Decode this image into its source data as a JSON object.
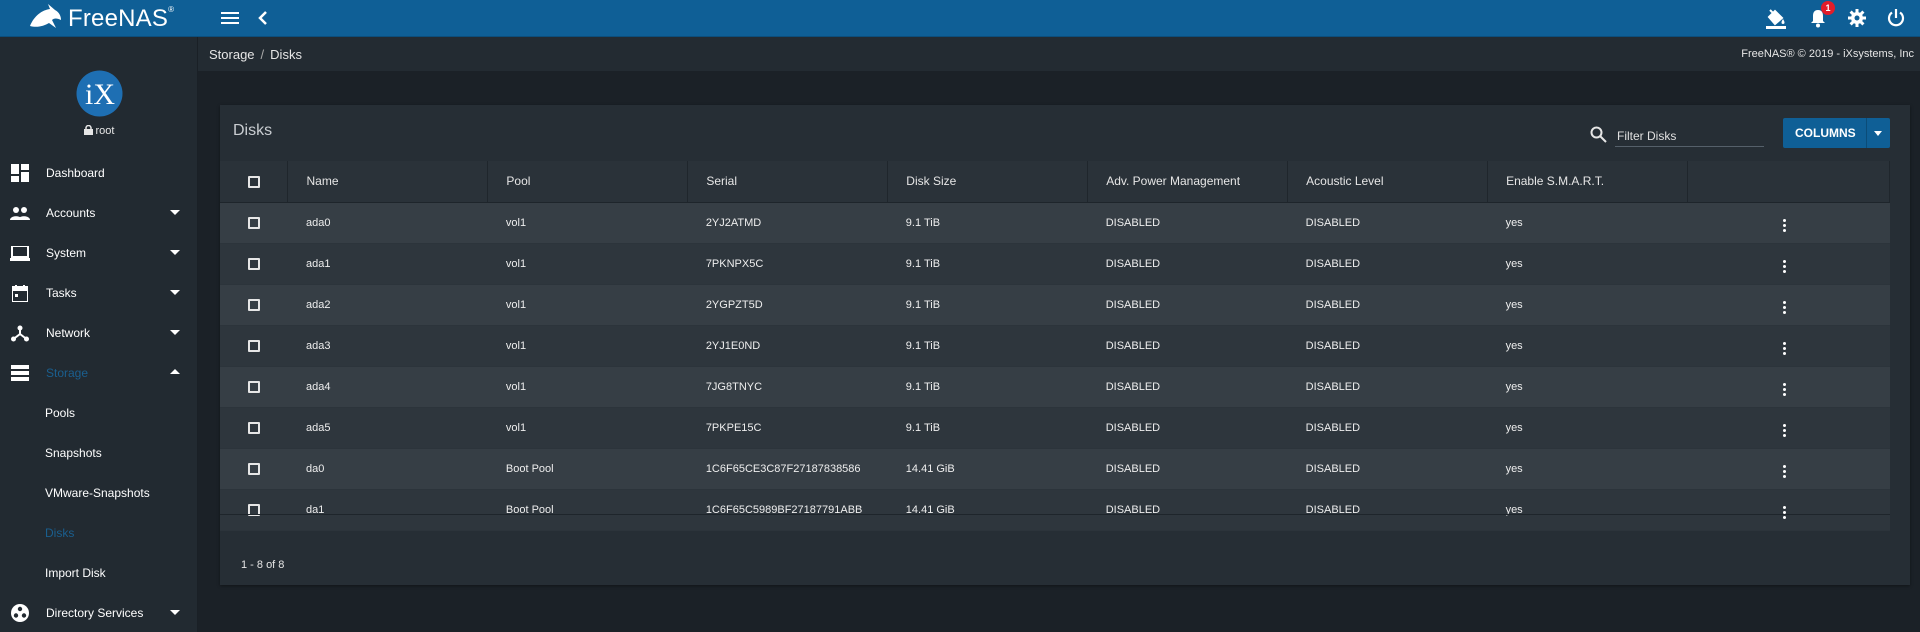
{
  "app": {
    "name": "FreeNAS",
    "trademark": "®",
    "notification_count": "1"
  },
  "topbar": {
    "icons": [
      "menu-icon",
      "chevron-left-icon",
      "paint-bucket-icon",
      "bell-icon",
      "gear-icon",
      "power-icon"
    ]
  },
  "sidebar": {
    "user": "root",
    "items": [
      {
        "label": "Dashboard",
        "icon": "dashboard-icon"
      },
      {
        "label": "Accounts",
        "icon": "people-icon"
      },
      {
        "label": "System",
        "icon": "laptop-icon"
      },
      {
        "label": "Tasks",
        "icon": "calendar-icon"
      },
      {
        "label": "Network",
        "icon": "network-icon"
      },
      {
        "label": "Storage",
        "icon": "storage-icon"
      }
    ],
    "storage_sub": [
      "Pools",
      "Snapshots",
      "VMware-Snapshots",
      "Disks",
      "Import Disk"
    ],
    "last_item": {
      "label": "Directory Services",
      "icon": "directory-icon"
    }
  },
  "breadcrumb": {
    "parent": "Storage",
    "sep": "/",
    "current": "Disks"
  },
  "copyright": "FreeNAS® © 2019 - iXsystems, Inc",
  "card": {
    "title": "Disks",
    "filter_placeholder": "Filter Disks",
    "columns_button": "COLUMNS",
    "pager": "1 - 8 of 8"
  },
  "table": {
    "headers": [
      "Name",
      "Pool",
      "Serial",
      "Disk Size",
      "Adv. Power Management",
      "Acoustic Level",
      "Enable S.M.A.R.T."
    ],
    "rows": [
      [
        "ada0",
        "vol1",
        "2YJ2ATMD",
        "9.1 TiB",
        "DISABLED",
        "DISABLED",
        "yes"
      ],
      [
        "ada1",
        "vol1",
        "7PKNPX5C",
        "9.1 TiB",
        "DISABLED",
        "DISABLED",
        "yes"
      ],
      [
        "ada2",
        "vol1",
        "2YGPZT5D",
        "9.1 TiB",
        "DISABLED",
        "DISABLED",
        "yes"
      ],
      [
        "ada3",
        "vol1",
        "2YJ1E0ND",
        "9.1 TiB",
        "DISABLED",
        "DISABLED",
        "yes"
      ],
      [
        "ada4",
        "vol1",
        "7JG8TNYC",
        "9.1 TiB",
        "DISABLED",
        "DISABLED",
        "yes"
      ],
      [
        "ada5",
        "vol1",
        "7PKPE15C",
        "9.1 TiB",
        "DISABLED",
        "DISABLED",
        "yes"
      ],
      [
        "da0",
        "Boot Pool",
        "1C6F65CE3C87F27187838586",
        "14.41 GiB",
        "DISABLED",
        "DISABLED",
        "yes"
      ],
      [
        "da1",
        "Boot Pool",
        "1C6F65C5989BF27187791ABB",
        "14.41 GiB",
        "DISABLED",
        "DISABLED",
        "yes"
      ]
    ]
  },
  "colors": {
    "topbar": "#0f5f96",
    "accent": "#0f5f96",
    "active_nav": "#1a5f8f",
    "badge": "#e11d2a"
  }
}
